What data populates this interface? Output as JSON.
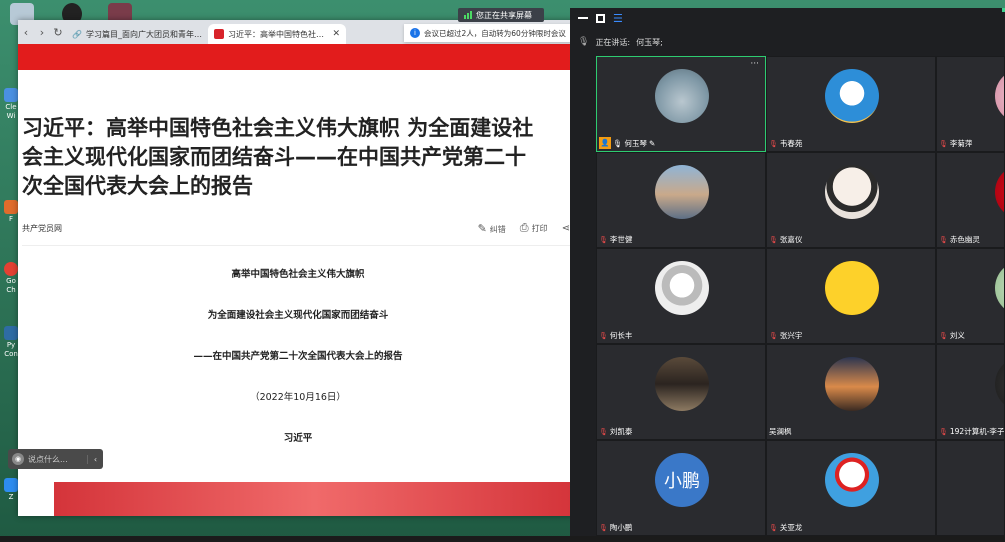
{
  "browser": {
    "tabs": [
      {
        "title": "学习篇目_面向广大团员和青年开展",
        "active": false
      },
      {
        "title": "习近平：高举中国特色社会主义",
        "active": true
      }
    ]
  },
  "share_indicator": "您正在共享屏幕",
  "notice": "会议已超过2人，自动转为60分钟限时会议",
  "article": {
    "headline_lines": [
      "习近平：高举中国特色社会主义伟大旗帜 为全面建设社",
      "会主义现代化国家而团结奋斗——在中国共产党第二十",
      "次全国代表大会上的报告"
    ],
    "source": "共产党员网",
    "actions": {
      "correct": "纠错",
      "print": "打印"
    },
    "body": [
      "高举中国特色社会主义伟大旗帜",
      "为全面建设社会主义现代化国家而团结奋斗",
      "——在中国共产党第二十次全国代表大会上的报告",
      "（2022年10月16日）",
      "习近平"
    ]
  },
  "comment_placeholder": "说点什么...",
  "meeting": {
    "speaking_label": "正在讲话:",
    "speaker": "何玉琴;",
    "participants": [
      {
        "name": "何玉琴",
        "role": "host",
        "avatar": "sea",
        "highlight": true
      },
      {
        "name": "韦春苑",
        "avatar": "doraemon"
      },
      {
        "name": "李菊萍",
        "avatar": "pink"
      },
      {
        "name": "李世健",
        "avatar": "city"
      },
      {
        "name": "张嘉仪",
        "avatar": "anime"
      },
      {
        "name": "赤色幽灵",
        "avatar": "red"
      },
      {
        "name": "何长丰",
        "avatar": "sketch"
      },
      {
        "name": "张兴宇",
        "avatar": "yellow"
      },
      {
        "name": "刘义",
        "avatar": "green"
      },
      {
        "name": "刘凯泰",
        "avatar": "window"
      },
      {
        "name": "吴澜枫",
        "avatar": "sunset",
        "no_mute_icon": true
      },
      {
        "name": "192计算机-李子",
        "avatar": "dark"
      },
      {
        "name": "陶小鹏",
        "avatar": "text",
        "avatar_text": "小鹏"
      },
      {
        "name": "关亚龙",
        "avatar": "snowman"
      },
      {
        "name": "",
        "avatar": "none"
      }
    ]
  }
}
